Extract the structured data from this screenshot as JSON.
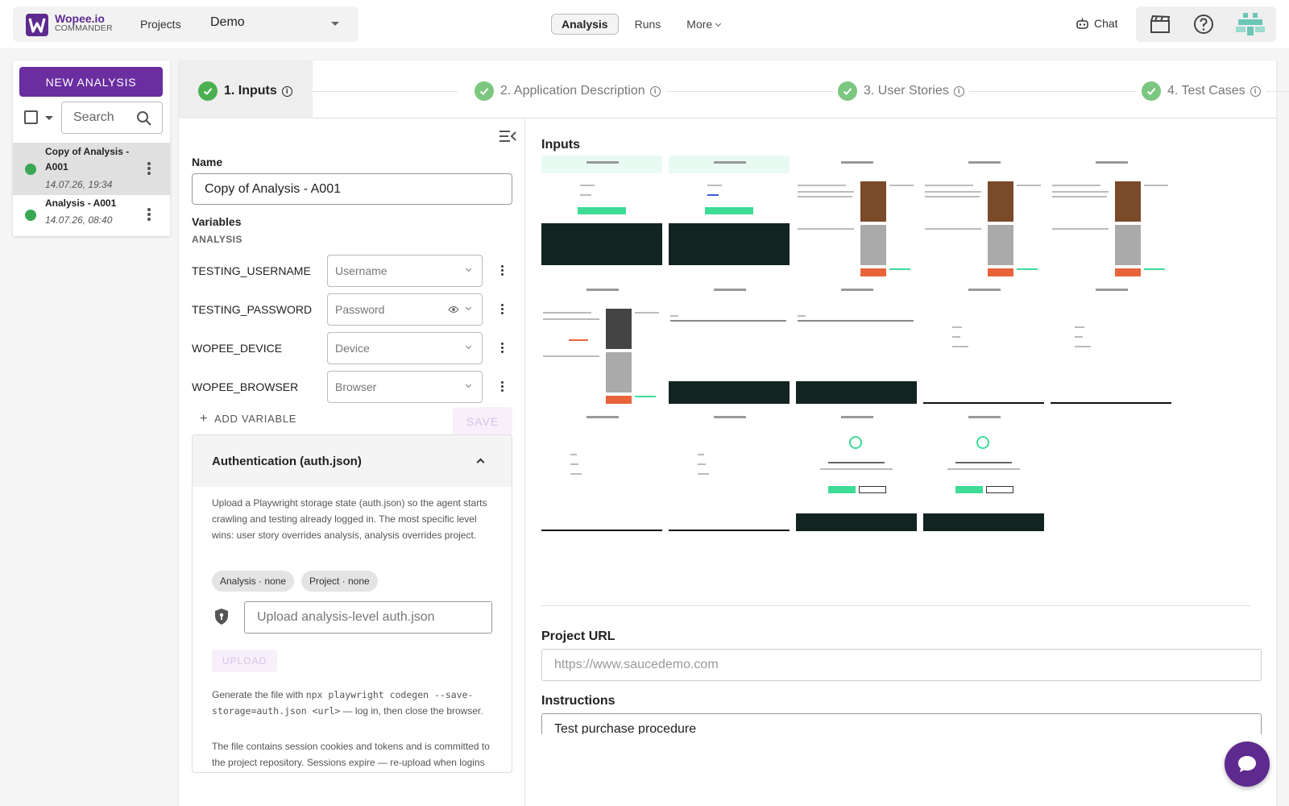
{
  "brand": {
    "name": "Wopee.io",
    "subtitle": "COMMANDER",
    "accent": "#6a2ea0"
  },
  "header": {
    "projects_label": "Projects",
    "project_selected": "Demo",
    "tabs": [
      {
        "label": "Analysis",
        "active": true
      },
      {
        "label": "Runs",
        "active": false
      },
      {
        "label": "More",
        "active": false
      }
    ],
    "chat_label": "Chat",
    "icons": [
      "clapperboard-icon",
      "help-circle-icon",
      "user-avatar-icon",
      "robot-icon"
    ]
  },
  "sidebar": {
    "new_button": "NEW ANALYSIS",
    "search_placeholder": "Search",
    "items": [
      {
        "title": "Copy of Analysis - A001",
        "date": "14.07.26, 19:34",
        "status": "green",
        "selected": true
      },
      {
        "title": "Analysis - A001",
        "date": "14.07.26, 08:40",
        "status": "green",
        "selected": false
      }
    ]
  },
  "stepper": {
    "steps": [
      {
        "label": "1. Inputs",
        "state": "active"
      },
      {
        "label": "2. Application Description",
        "state": "done"
      },
      {
        "label": "3. User Stories",
        "state": "done"
      },
      {
        "label": "4. Test Cases",
        "state": "done"
      }
    ]
  },
  "form": {
    "name_label": "Name",
    "name_value": "Copy of Analysis - A001",
    "variables_label": "Variables",
    "section_label": "ANALYSIS",
    "variables": [
      {
        "name": "TESTING_USERNAME",
        "placeholder": "Username",
        "has_eye": false
      },
      {
        "name": "TESTING_PASSWORD",
        "placeholder": "Password",
        "has_eye": true
      },
      {
        "name": "WOPEE_DEVICE",
        "placeholder": "Device",
        "has_eye": false
      },
      {
        "name": "WOPEE_BROWSER",
        "placeholder": "Browser",
        "has_eye": false
      }
    ],
    "add_variable": "ADD VARIABLE",
    "save": "SAVE"
  },
  "auth": {
    "title": "Authentication (auth.json)",
    "description": "Upload a Playwright storage state (auth.json) so the agent starts crawling and testing already logged in. The most specific level wins: user story overrides analysis, analysis overrides project.",
    "chips": [
      "Analysis · none",
      "Project · none"
    ],
    "upload_placeholder": "Upload analysis-level auth.json",
    "upload_button": "UPLOAD",
    "gen_prefix": "Generate the file with ",
    "gen_code": "npx playwright codegen --save-storage=auth.json <url>",
    "gen_suffix": " — log in, then close the browser.",
    "file_note": "The file contains session cookies and tokens and is committed to the project repository. Sessions expire — re-upload when logins stop working."
  },
  "inputs": {
    "title": "Inputs",
    "thumbnail_count": 14
  },
  "project_url": {
    "label": "Project URL",
    "placeholder": "https://www.saucedemo.com"
  },
  "instructions": {
    "label": "Instructions",
    "value": "Test purchase procedure"
  }
}
